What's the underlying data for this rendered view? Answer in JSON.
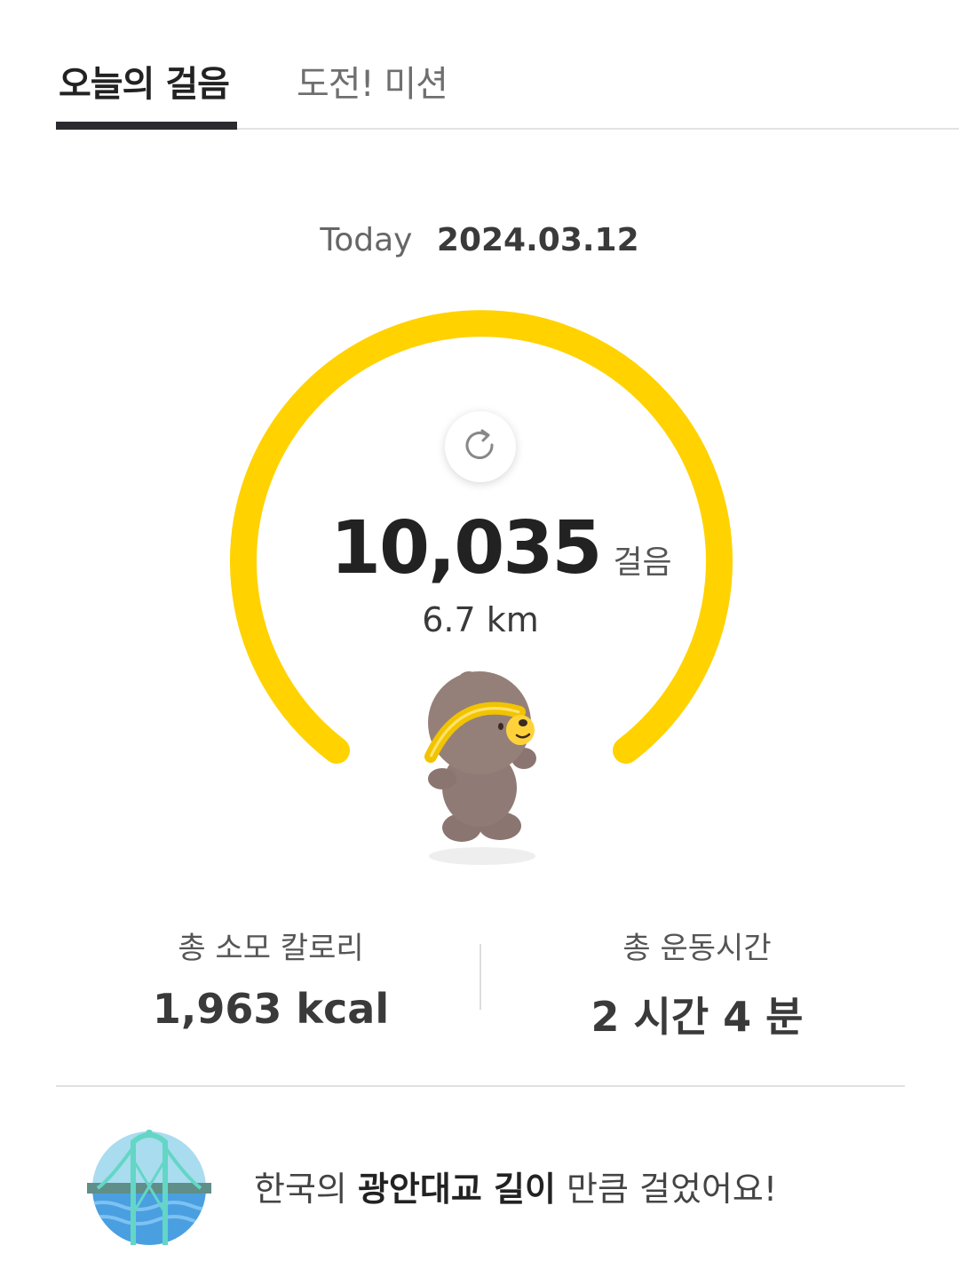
{
  "tabs": {
    "active": "오늘의 걸음",
    "inactive": "도전! 미션"
  },
  "date": {
    "label": "Today",
    "value": "2024.03.12"
  },
  "steps": {
    "value": "10,035",
    "unit": "걸음",
    "distance": "6.7 km"
  },
  "gauge": {
    "color": "#FFD200",
    "icon": "refresh-icon"
  },
  "mascot": {
    "icon": "running-bear-icon"
  },
  "stats": {
    "calories_label": "총 소모 칼로리",
    "calories_value": "1,963 kcal",
    "time_label": "총 운동시간",
    "time_value": "2 시간 4 분"
  },
  "achievement": {
    "icon": "bridge-icon",
    "prefix": "한국의 ",
    "highlight": "광안대교 길이",
    "suffix": " 만큼 걸었어요!"
  }
}
